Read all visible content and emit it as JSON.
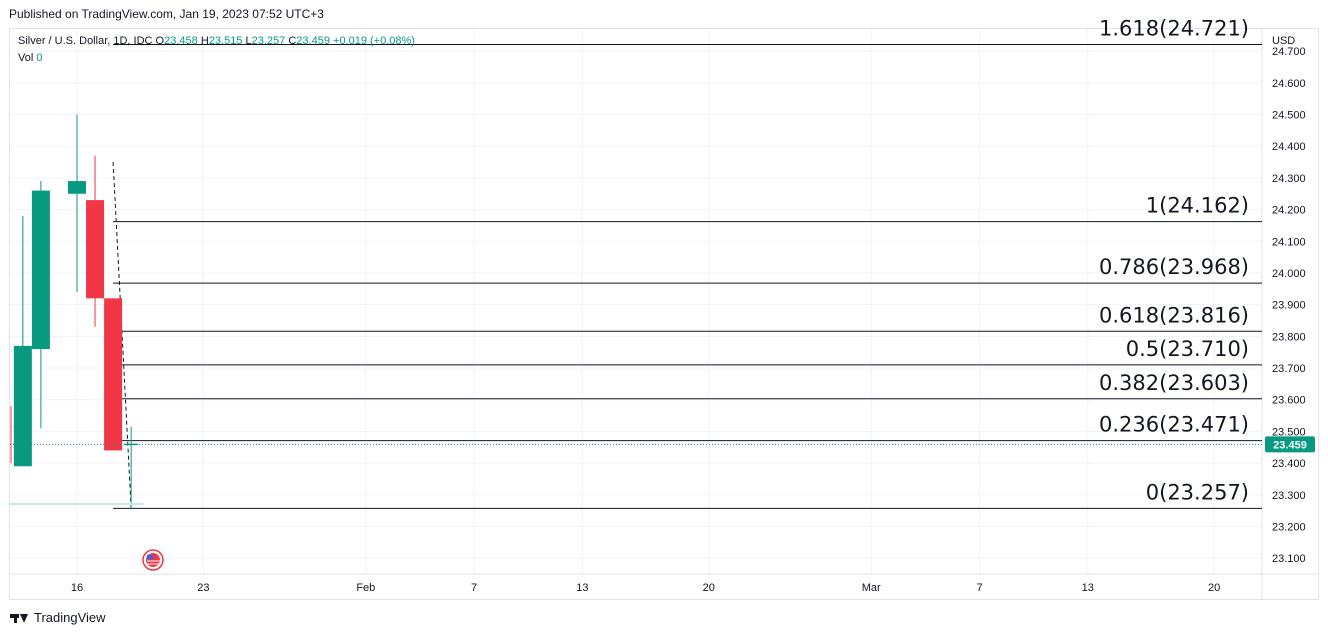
{
  "published": "Published on TradingView.com, Jan 19, 2023 07:52 UTC+3",
  "legend": {
    "symbol": "Silver / U.S. Dollar, 1D, IDC",
    "o_label": "O",
    "o_value": "23.458",
    "h_label": "H",
    "h_value": "23.515",
    "l_label": "L",
    "l_value": "23.257",
    "c_label": "C",
    "c_value": "23.459",
    "change": "+0.019 (+0.08%)",
    "vol_label": "Vol",
    "vol_value": "0"
  },
  "currency": "USD",
  "footer": {
    "brand": "TradingView"
  },
  "colors": {
    "up": "#089981",
    "down": "#f23645",
    "text": "#131722",
    "grid": "#f0f3fa",
    "price_tag": "#089981"
  },
  "chart_data": {
    "type": "candlestick",
    "ylim": [
      23.05,
      24.77
    ],
    "y_ticks": [
      "23.100",
      "23.200",
      "23.300",
      "23.400",
      "23.500",
      "23.600",
      "23.700",
      "23.800",
      "23.900",
      "24.000",
      "24.100",
      "24.200",
      "24.300",
      "24.400",
      "24.500",
      "24.600",
      "24.700"
    ],
    "x_ticks": [
      {
        "label": "16",
        "day": 16
      },
      {
        "label": "23",
        "day": 23
      },
      {
        "label": "Feb",
        "day": 32
      },
      {
        "label": "7",
        "day": 38
      },
      {
        "label": "13",
        "day": 44
      },
      {
        "label": "20",
        "day": 51
      },
      {
        "label": "Mar",
        "day": 60
      },
      {
        "label": "7",
        "day": 66
      },
      {
        "label": "13",
        "day": 72
      },
      {
        "label": "20",
        "day": 79
      }
    ],
    "candles": [
      {
        "day": 13,
        "open": 23.39,
        "high": 24.18,
        "low": 23.39,
        "close": 23.77
      },
      {
        "day": 14,
        "open": 23.76,
        "high": 24.29,
        "low": 23.51,
        "close": 24.26
      },
      {
        "day": 16,
        "open": 24.25,
        "high": 24.5,
        "low": 23.94,
        "close": 24.29
      },
      {
        "day": 17,
        "open": 24.23,
        "high": 24.37,
        "low": 23.83,
        "close": 23.92
      },
      {
        "day": 18,
        "open": 23.92,
        "high": 23.92,
        "low": 23.44,
        "close": 23.44
      },
      {
        "day": 19,
        "open": 23.458,
        "high": 23.515,
        "low": 23.257,
        "close": 23.459
      }
    ],
    "current_price": "23.459",
    "fib_levels": [
      {
        "label": "1.618(24.721)",
        "value": 24.721
      },
      {
        "label": "1(24.162)",
        "value": 24.162
      },
      {
        "label": "0.786(23.968)",
        "value": 23.968
      },
      {
        "label": "0.618(23.816)",
        "value": 23.816
      },
      {
        "label": "0.5(23.710)",
        "value": 23.71
      },
      {
        "label": "0.382(23.603)",
        "value": 23.603
      },
      {
        "label": "0.236(23.471)",
        "value": 23.471
      },
      {
        "label": "0(23.257)",
        "value": 23.257
      }
    ],
    "fib_trend": {
      "from": {
        "day": 18,
        "value": 24.35
      },
      "to": {
        "day": 19,
        "value": 23.257
      }
    }
  }
}
